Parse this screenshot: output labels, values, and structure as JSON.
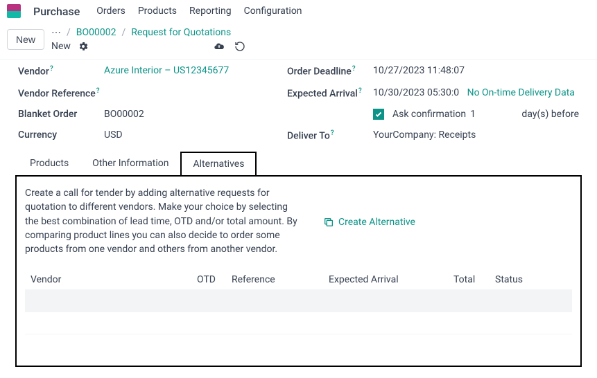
{
  "topnav": {
    "app": "Purchase",
    "menus": [
      "Orders",
      "Products",
      "Reporting",
      "Configuration"
    ]
  },
  "toolbar": {
    "new_button": "New",
    "new_text": "New"
  },
  "breadcrumb": {
    "dots": "⋯",
    "order": "BO00002",
    "page": "Request for Quotations"
  },
  "form": {
    "vendor": {
      "label": "Vendor",
      "value": "Azure Interior – US12345677"
    },
    "vendor_ref": {
      "label": "Vendor Reference",
      "value": ""
    },
    "blanket_order": {
      "label": "Blanket Order",
      "value": "BO00002"
    },
    "currency": {
      "label": "Currency",
      "value": "USD"
    },
    "order_deadline": {
      "label": "Order Deadline",
      "value": "10/27/2023 11:48:07"
    },
    "expected_arrival": {
      "label": "Expected Arrival",
      "value": "10/30/2023 05:30:0",
      "otd": "No On-time Delivery Data"
    },
    "ask_confirmation": {
      "label": "Ask confirmation",
      "days": "1",
      "suffix": "day(s) before"
    },
    "deliver_to": {
      "label": "Deliver To",
      "value": "YourCompany: Receipts"
    }
  },
  "tabs": {
    "products": "Products",
    "other": "Other Information",
    "alternatives": "Alternatives"
  },
  "alternatives": {
    "help": "Create a call for tender by adding alternative requests for quotation to different vendors. Make your choice by selecting the best combination of lead time, OTD and/or total amount. By comparing product lines you can also decide to order some products from one vendor and others from another vendor.",
    "create": "Create Alternative",
    "columns": {
      "vendor": "Vendor",
      "otd": "OTD",
      "reference": "Reference",
      "expected": "Expected Arrival",
      "total": "Total",
      "status": "Status"
    }
  }
}
